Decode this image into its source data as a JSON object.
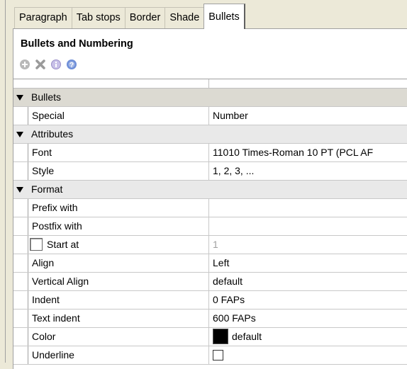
{
  "tabs": [
    {
      "label": "Paragraph",
      "active": false
    },
    {
      "label": "Tab stops",
      "active": false
    },
    {
      "label": "Border",
      "active": false
    },
    {
      "label": "Shade",
      "active": false
    },
    {
      "label": "Bullets",
      "active": true
    }
  ],
  "panel": {
    "title": "Bullets and Numbering",
    "toolbar": [
      "add-icon",
      "delete-icon",
      "info-icon",
      "help-icon"
    ]
  },
  "grid": {
    "groups": {
      "bullets": "Bullets",
      "attributes": "Attributes",
      "format": "Format"
    },
    "special": {
      "label": "Special",
      "value": "Number"
    },
    "font": {
      "label": "Font",
      "value": "11010 Times-Roman 10 PT (PCL AF"
    },
    "style": {
      "label": "Style",
      "value": "1, 2, 3, ..."
    },
    "prefix": {
      "label": "Prefix with",
      "value": ""
    },
    "postfix": {
      "label": "Postfix with",
      "value": ""
    },
    "start_at": {
      "label": "Start at",
      "value": "1",
      "checked": false
    },
    "align": {
      "label": "Align",
      "value": "Left"
    },
    "valign": {
      "label": "Vertical Align",
      "value": "default"
    },
    "indent": {
      "label": "Indent",
      "value": "0 FAPs"
    },
    "text_indent": {
      "label": "Text indent",
      "value": "600 FAPs"
    },
    "color": {
      "label": "Color",
      "value": "default",
      "swatch": "#000000"
    },
    "underline": {
      "label": "Underline",
      "checked": false
    }
  }
}
